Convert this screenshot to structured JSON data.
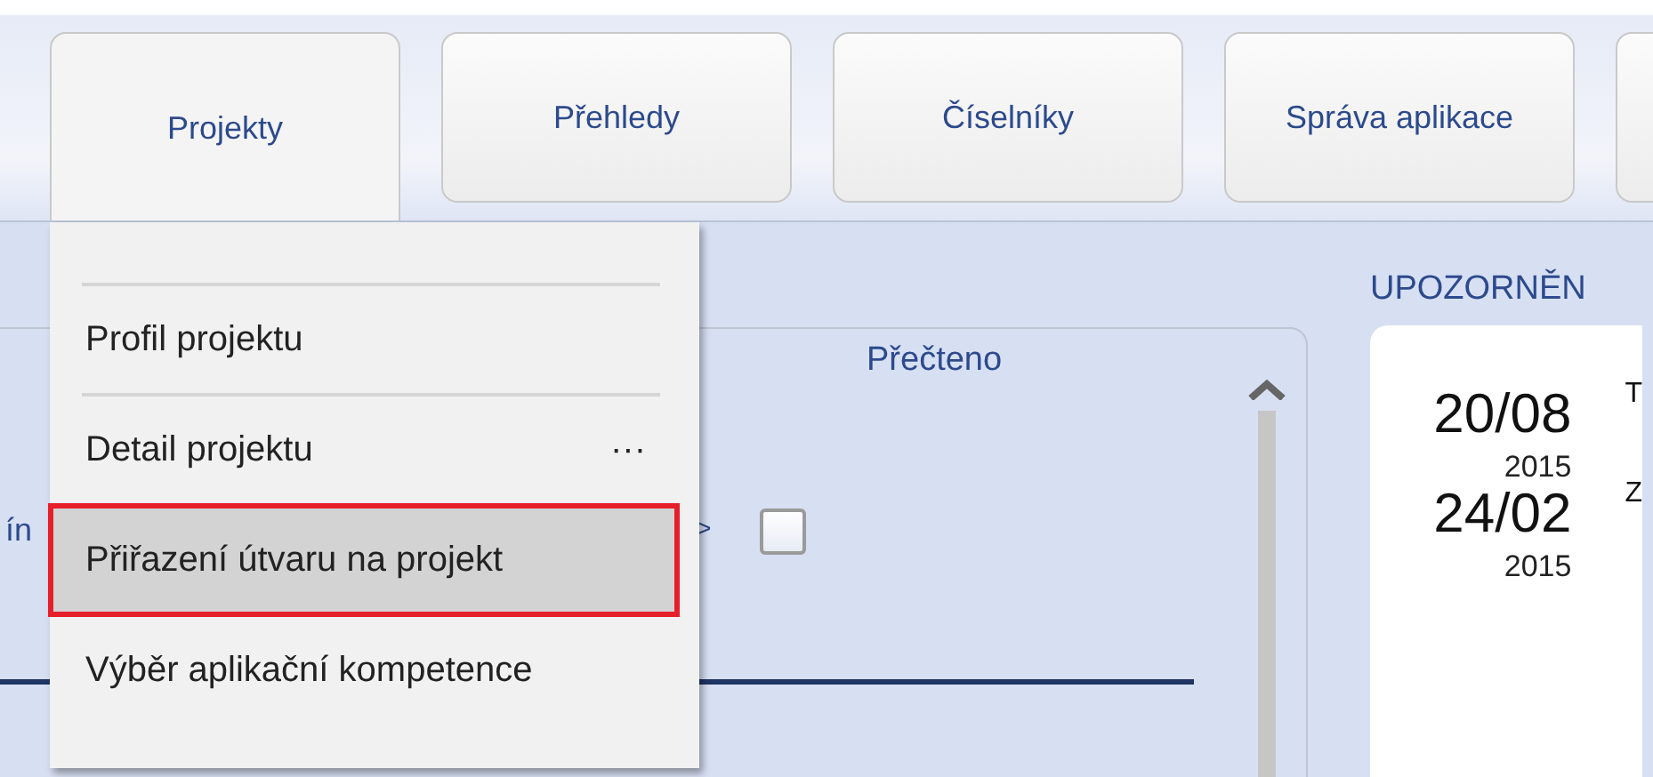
{
  "tabs": [
    {
      "label": "Projekty",
      "selected": true
    },
    {
      "label": "Přehledy",
      "selected": false
    },
    {
      "label": "Číselníky",
      "selected": false
    },
    {
      "label": "Správa aplikace",
      "selected": false
    }
  ],
  "menu": {
    "items": [
      {
        "label": "Profil projektu",
        "selected": false
      },
      {
        "label": "Detail projektu",
        "selected": false,
        "more": "···"
      },
      {
        "label": "Přiřazení útvaru na projekt",
        "selected": true
      },
      {
        "label": "Výběr aplikační kompetence",
        "selected": false
      }
    ]
  },
  "panel": {
    "column_header": "Přečteno",
    "row": {
      "cut_text": "ín",
      "arrow": ">",
      "checked": false
    }
  },
  "notices": {
    "title": "UPOZORNĚN",
    "entries": [
      {
        "date": "20/08",
        "year": "2015",
        "text": "T"
      },
      {
        "date": "24/02",
        "year": "2015",
        "text": "Z"
      }
    ]
  }
}
